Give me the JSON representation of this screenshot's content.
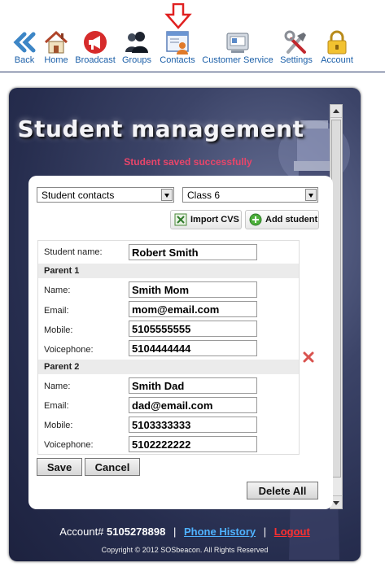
{
  "nav": {
    "items": [
      {
        "label": "Back",
        "icon": "back-arrow-icon"
      },
      {
        "label": "Home",
        "icon": "home-icon"
      },
      {
        "label": "Broadcast",
        "icon": "megaphone-icon"
      },
      {
        "label": "Groups",
        "icon": "groups-icon"
      },
      {
        "label": "Contacts",
        "icon": "contacts-icon"
      },
      {
        "label": "Customer Service",
        "icon": "customer-service-icon"
      },
      {
        "label": "Settings",
        "icon": "settings-tools-icon"
      },
      {
        "label": "Account",
        "icon": "lock-icon"
      }
    ],
    "active_indicator_icon": "red-down-arrow-icon"
  },
  "panel": {
    "title": "Student management",
    "status": "Student saved successfully"
  },
  "filters": {
    "contact_type": "Student contacts",
    "class": "Class 6"
  },
  "actions": {
    "import_label": "Import CVS",
    "add_student_label": "Add student"
  },
  "student": {
    "name_label": "Student name:",
    "name_value": "Robert Smith"
  },
  "parent1": {
    "heading": "Parent 1",
    "name_label": "Name:",
    "name_value": "Smith Mom",
    "email_label": "Email:",
    "email_value": "mom@email.com",
    "mobile_label": "Mobile:",
    "mobile_value": "5105555555",
    "voice_label": "Voicephone:",
    "voice_value": "5104444444"
  },
  "parent2": {
    "heading": "Parent 2",
    "name_label": "Name:",
    "name_value": "Smith Dad",
    "email_label": "Email:",
    "email_value": "dad@email.com",
    "mobile_label": "Mobile:",
    "mobile_value": "5103333333",
    "voice_label": "Voicephone:",
    "voice_value": "5102222222"
  },
  "buttons": {
    "save": "Save",
    "cancel": "Cancel",
    "delete_all": "Delete All"
  },
  "footer": {
    "account_label": "Account#",
    "account_number": "5105278898",
    "separator": "|",
    "phone_history": "Phone History",
    "logout": "Logout",
    "copyright": "Copyright © 2012 SOSbeacon. All Rights Reserved"
  },
  "colors": {
    "nav_label": "#1b5fa8",
    "status_text": "#e8456a",
    "phone_history_link": "#4fb2ff",
    "logout_link": "#ff3030",
    "delete_x": "#d9534f"
  }
}
